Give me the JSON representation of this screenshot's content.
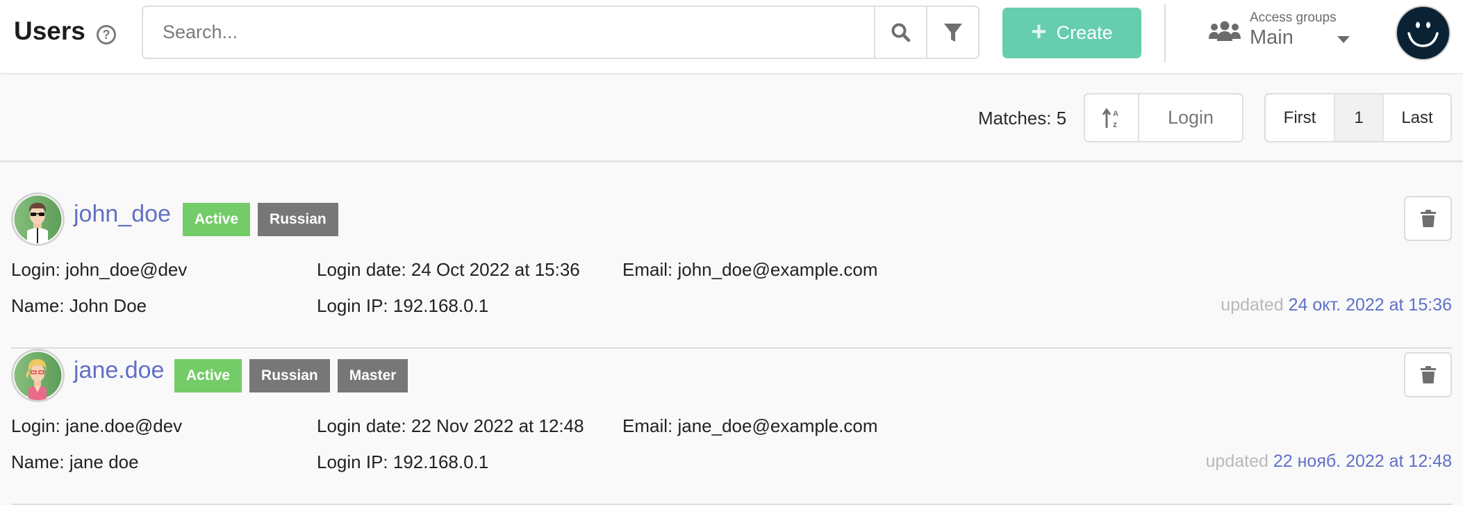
{
  "header": {
    "title": "Users",
    "search_placeholder": "Search...",
    "search_value": "",
    "create_label": "Create",
    "access_groups_label": "Access groups",
    "access_groups_value": "Main",
    "brand_color": "#66cdaf",
    "link_color": "#6070c7"
  },
  "toolbar": {
    "matches_label": "Matches: 5",
    "sort_field": "Login",
    "pager": {
      "first": "First",
      "current": "1",
      "last": "Last"
    }
  },
  "users": [
    {
      "username": "john_doe",
      "avatar": "male-avatar",
      "badges": [
        "Active",
        "Russian"
      ],
      "login_label": "Login:",
      "login": "john_doe@dev",
      "name_label": "Name:",
      "name": "John Doe",
      "login_date_label": "Login date:",
      "login_date": "24 Oct 2022 at 15:36",
      "login_ip_label": "Login IP:",
      "login_ip": "192.168.0.1",
      "email_label": "Email:",
      "email": "john_doe@example.com",
      "updated_label": "updated",
      "updated": "24 окт. 2022 at 15:36"
    },
    {
      "username": "jane.doe",
      "avatar": "female-avatar",
      "badges": [
        "Active",
        "Russian",
        "Master"
      ],
      "login_label": "Login:",
      "login": "jane.doe@dev",
      "name_label": "Name:",
      "name": "jane doe",
      "login_date_label": "Login date:",
      "login_date": "22 Nov 2022 at 12:48",
      "login_ip_label": "Login IP:",
      "login_ip": "192.168.0.1",
      "email_label": "Email:",
      "email": "jane_doe@example.com",
      "updated_label": "updated",
      "updated": "22 нояб. 2022 at 12:48"
    }
  ]
}
